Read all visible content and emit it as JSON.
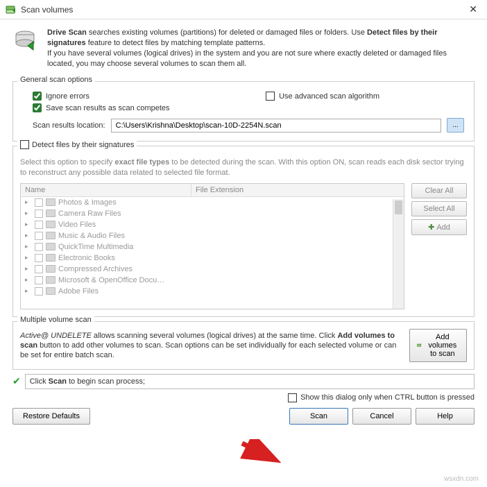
{
  "window": {
    "title": "Scan volumes"
  },
  "desc": {
    "bold1": "Drive Scan",
    "t1": " searches existing volumes (partitions) for deleted or damaged files or folders. Use ",
    "bold2": "Detect files by their signatures",
    "t2": " feature to detect files by matching template patterns.",
    "line2": "If you have several volumes (logical drives) in the system and you are not sure where exactly deleted or damaged files located, you may choose several volumes to scan them all."
  },
  "general": {
    "title": "General scan options",
    "ignore": "Ignore errors",
    "advanced": "Use advanced scan algorithm",
    "save": "Save scan results as scan competes",
    "loc_label": "Scan results location:",
    "loc_value": "C:\\Users\\Krishna\\Desktop\\scan-10D-2254N.scan",
    "browse": "..."
  },
  "sig": {
    "title": "Detect files by their signatures",
    "desc1": "Select this option to specify ",
    "desc_bold": "exact file types",
    "desc2": " to be detected during the scan. With this option ON, scan reads each disk sector trying to reconstruct any possible data related to selected file format.",
    "col1": "Name",
    "col2": "File Extension",
    "items": [
      "Photos & Images",
      "Camera Raw Files",
      "Video Files",
      "Music & Audio Files",
      "QuickTime Multimedia",
      "Electronic Books",
      "Compressed Archives",
      "Microsoft & OpenOffice Docu…",
      "Adobe Files"
    ],
    "clear": "Clear All",
    "select": "Select All",
    "add": "Add"
  },
  "multi": {
    "title": "Multiple volume scan",
    "desc_pre": "Active@ UNDELETE",
    "desc1": " allows scanning several volumes (logical drives) at the same time. Click ",
    "bold2": "Add volumes to scan",
    "desc2": " button to add other volumes to scan. Scan options can be set individually for each selected volume or can be set for entire batch scan.",
    "btn": "Add volumes to scan"
  },
  "status": {
    "text_pre": "Click ",
    "bold": "Scan",
    "text_post": " to begin scan process;"
  },
  "opt_show": "Show this dialog only when CTRL button is pressed",
  "buttons": {
    "restore": "Restore Defaults",
    "scan": "Scan",
    "cancel": "Cancel",
    "help": "Help"
  },
  "watermark": "wsxdn.com"
}
